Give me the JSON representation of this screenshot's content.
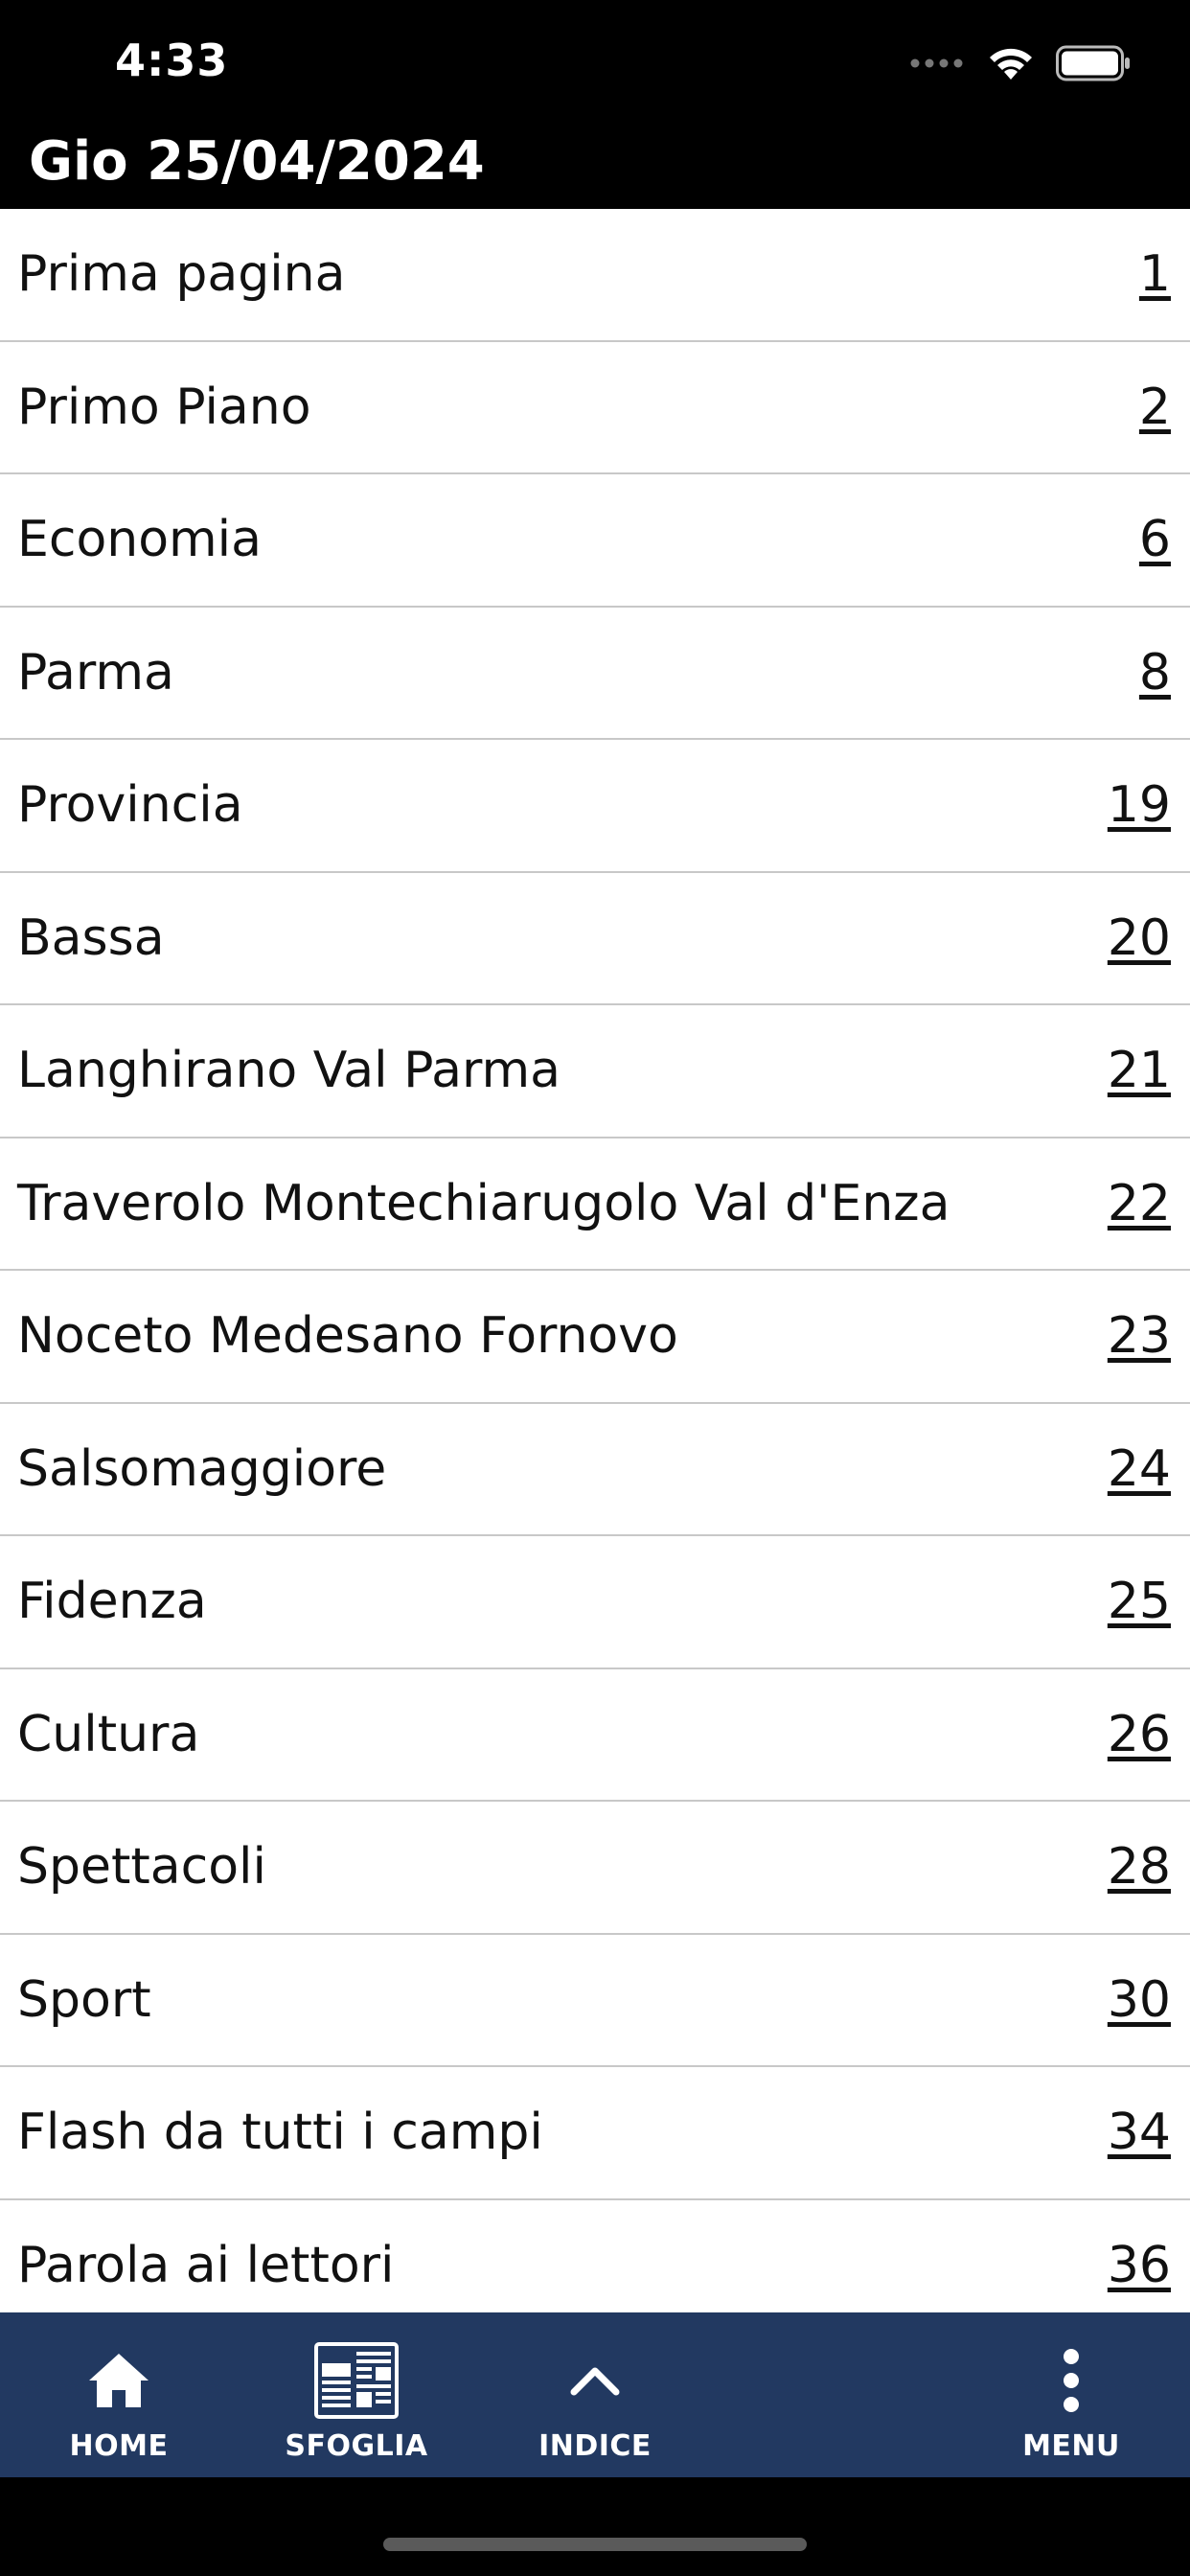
{
  "status": {
    "time": "4:33"
  },
  "header": {
    "title": "Gio 25/04/2024"
  },
  "sections": [
    {
      "label": "Prima pagina",
      "page": "1"
    },
    {
      "label": "Primo Piano",
      "page": "2"
    },
    {
      "label": "Economia",
      "page": "6"
    },
    {
      "label": "Parma",
      "page": "8"
    },
    {
      "label": "Provincia",
      "page": "19"
    },
    {
      "label": "Bassa",
      "page": "20"
    },
    {
      "label": "Langhirano Val Parma",
      "page": "21"
    },
    {
      "label": "Traverolo Montechiarugolo Val d'Enza",
      "page": "22"
    },
    {
      "label": "Noceto Medesano Fornovo",
      "page": "23"
    },
    {
      "label": "Salsomaggiore",
      "page": "24"
    },
    {
      "label": "Fidenza",
      "page": "25"
    },
    {
      "label": "Cultura",
      "page": "26"
    },
    {
      "label": "Spettacoli",
      "page": "28"
    },
    {
      "label": "Sport",
      "page": "30"
    },
    {
      "label": "Flash da tutti i campi",
      "page": "34"
    },
    {
      "label": "Parola ai lettori",
      "page": "36"
    }
  ],
  "tabbar": {
    "home": {
      "label": "HOME",
      "icon": "home-icon"
    },
    "sfoglia": {
      "label": "SFOGLIA",
      "icon": "newspaper-icon"
    },
    "indice": {
      "label": "INDICE",
      "icon": "chevron-up-icon"
    },
    "menu": {
      "label": "MENU",
      "icon": "more-vertical-icon"
    }
  },
  "colors": {
    "tabbar_bg": "#223961",
    "header_bg": "#000000",
    "list_bg": "#ffffff"
  }
}
